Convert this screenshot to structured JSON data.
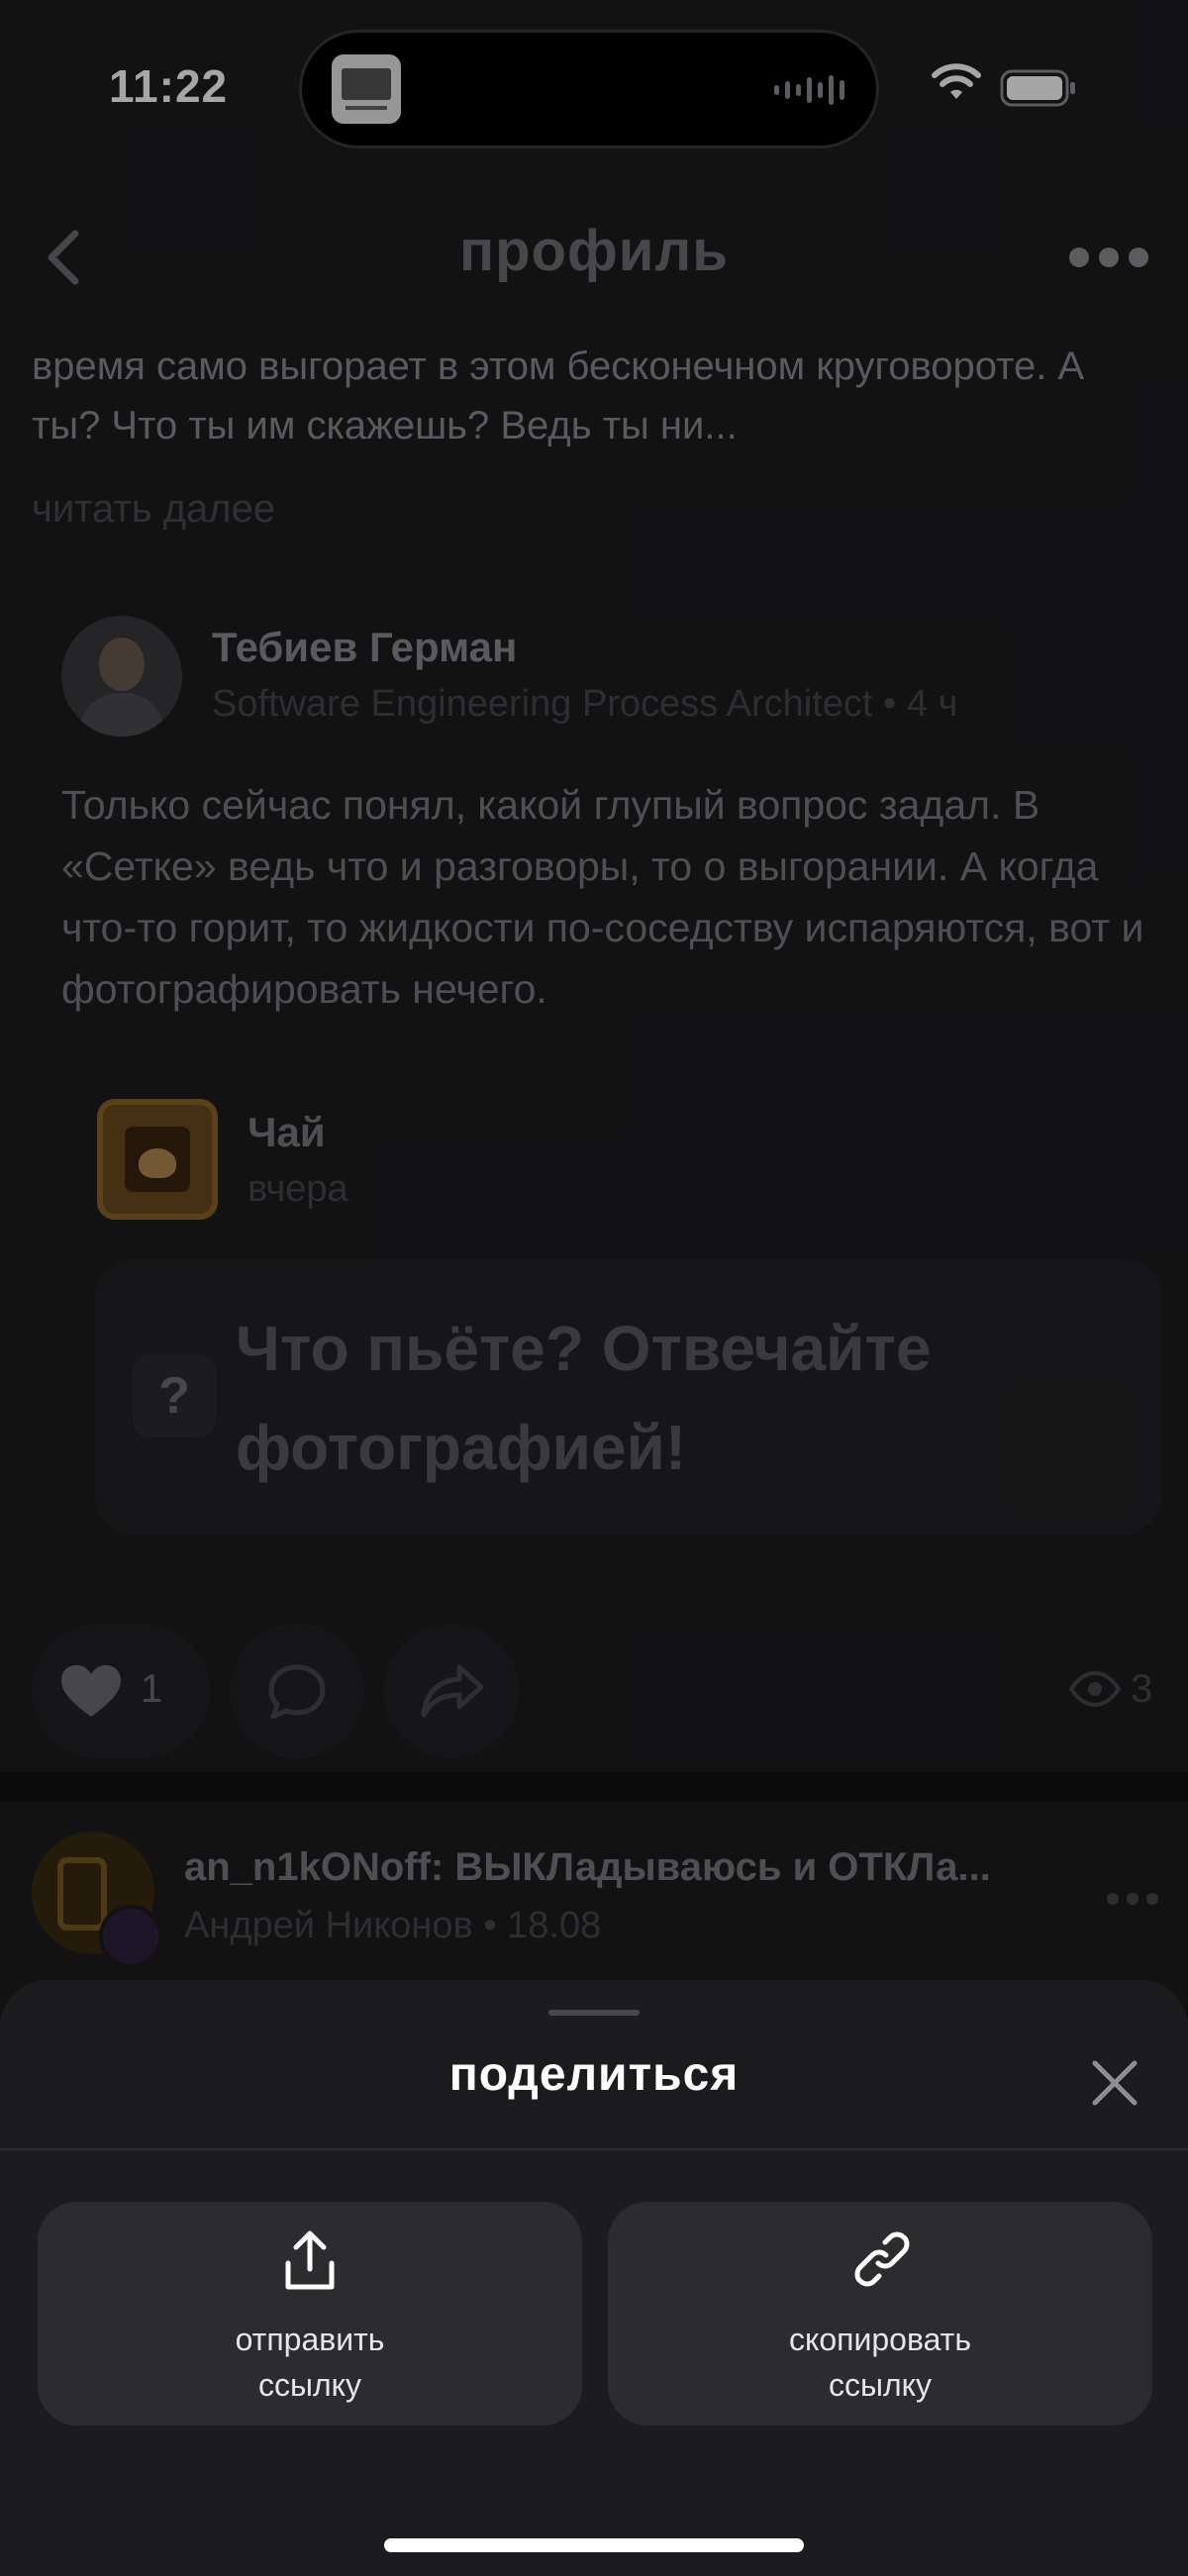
{
  "status_bar": {
    "time": "11:22"
  },
  "header": {
    "title": "профиль"
  },
  "previous_post": {
    "text": "время само выгорает в этом бесконечном круговороте. А ты? Что ты им скажешь? Ведь ты ни...",
    "read_more": "читать далее"
  },
  "comment": {
    "author": "Тебиев Герман",
    "role": "Software Engineering Process Architect",
    "time": "4 ч",
    "body": "Только сейчас понял, какой глупый вопрос задал. В «Сетке» ведь что и разговоры, то о выгорании. А когда что-то горит, то жидкости по-соседству испаряются, вот и фотографировать нечего.",
    "quoted": {
      "name": "Чай",
      "date": "вчера",
      "badge": "?",
      "question": "Что пьёте? Отвечайте фотографией!"
    },
    "likes": "1",
    "views": "3"
  },
  "next_post": {
    "title": "an_n1kONoff: ВЫКЛадываюсь и ОТКЛа...",
    "author": "Андрей Никонов",
    "date": "18.08"
  },
  "share_sheet": {
    "title": "поделиться",
    "options": [
      {
        "label_line1": "отправить",
        "label_line2": "ссылку",
        "icon": "share-upload-icon"
      },
      {
        "label_line1": "скопировать",
        "label_line2": "ссылку",
        "icon": "link-icon"
      }
    ]
  },
  "colors": {
    "background": "#1c1c1e",
    "sheet": "#1c1c1e",
    "option_bg": "#2c2c2e",
    "text": "#ffffff"
  }
}
